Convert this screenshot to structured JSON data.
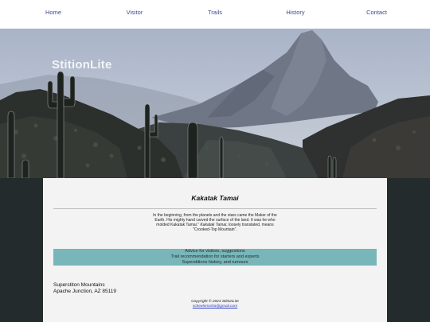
{
  "nav": {
    "items": [
      {
        "label": "Home"
      },
      {
        "label": "Visitor"
      },
      {
        "label": "Trails"
      },
      {
        "label": "History"
      },
      {
        "label": "Contact"
      }
    ]
  },
  "hero": {
    "site_title": "StitionLite"
  },
  "main": {
    "title": "Kakatak Tamai",
    "intro_before": "In the beginning, from the planets and the stars came the Maker of the Earth. His mighty hand carved the surface of the land. It was he who molded Kakatak Tamai.\" ",
    "intro_italic_1": "Kakatak Tamai",
    "intro_after": ", loosely translated, means \"Crooked-Top Mountain\".",
    "band_lines": [
      "Advice for visitors, suggestions",
      "Trail recommendation for starters and experts",
      "Superstitions history, and rumours"
    ]
  },
  "address": {
    "line1": "Superstiton Mountains",
    "line2": "Apache Junction, AZ 85119"
  },
  "footer": {
    "copyright": "Copyright © 2024 StitionLite",
    "email": "scheeleriosha@gmail.com"
  },
  "colors": {
    "nav_link": "#3d4c8a",
    "band": "#79b6b9",
    "page_bg": "#242b2c",
    "panel_bg": "#f3f3f3",
    "email_link": "#2c3cc7"
  }
}
